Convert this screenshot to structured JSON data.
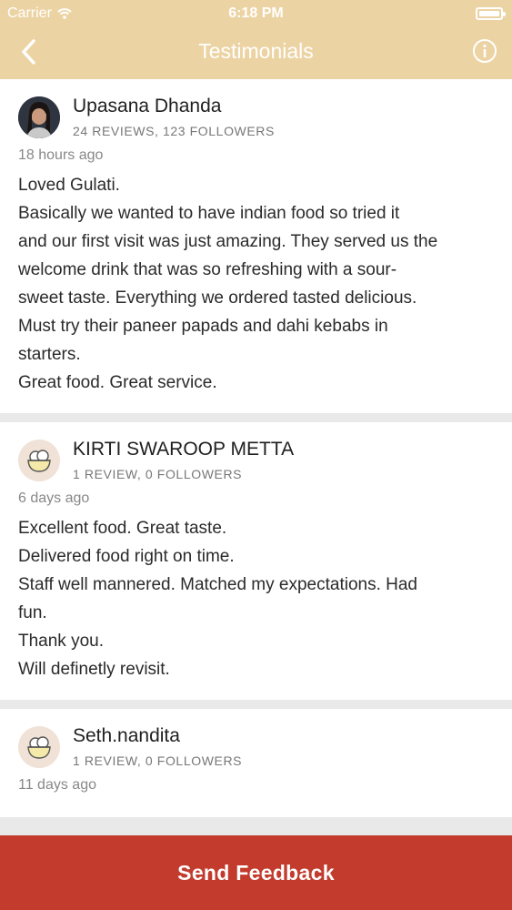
{
  "status_bar": {
    "carrier": "Carrier",
    "time": "6:18 PM"
  },
  "nav": {
    "title": "Testimonials"
  },
  "reviews": [
    {
      "name": "Upasana Dhanda",
      "meta": "24 REVIEWS, 123 FOLLOWERS",
      "time": "18 hours ago",
      "avatar": "user-photo",
      "lines": [
        "Loved Gulati.",
        "Basically  we wanted to have indian food so tried it",
        "and our first visit was just amazing. They served us the",
        "welcome drink that was so refreshing with a sour-",
        "sweet taste. Everything we ordered  tasted delicious.",
        "Must try their paneer papads and dahi kebabs in",
        "starters.",
        "Great food. Great service."
      ]
    },
    {
      "name": "KIRTI SWAROOP METTA",
      "meta": "1 REVIEW, 0 FOLLOWERS",
      "time": "6 days ago",
      "avatar": "ice-cream-icon",
      "lines": [
        "Excellent food. Great taste.",
        "Delivered food right on time.",
        "Staff well mannered. Matched my expectations. Had",
        "fun.",
        "Thank you.",
        "Will definetly revisit."
      ]
    },
    {
      "name": "Seth.nandita",
      "meta": "1 REVIEW, 0 FOLLOWERS",
      "time": "11 days ago",
      "avatar": "ice-cream-icon",
      "lines": []
    }
  ],
  "footer": {
    "button_label": "Send Feedback"
  },
  "colors": {
    "header": "#ecd3a3",
    "footer": "#c23b2d",
    "background": "#e9e9e9"
  }
}
